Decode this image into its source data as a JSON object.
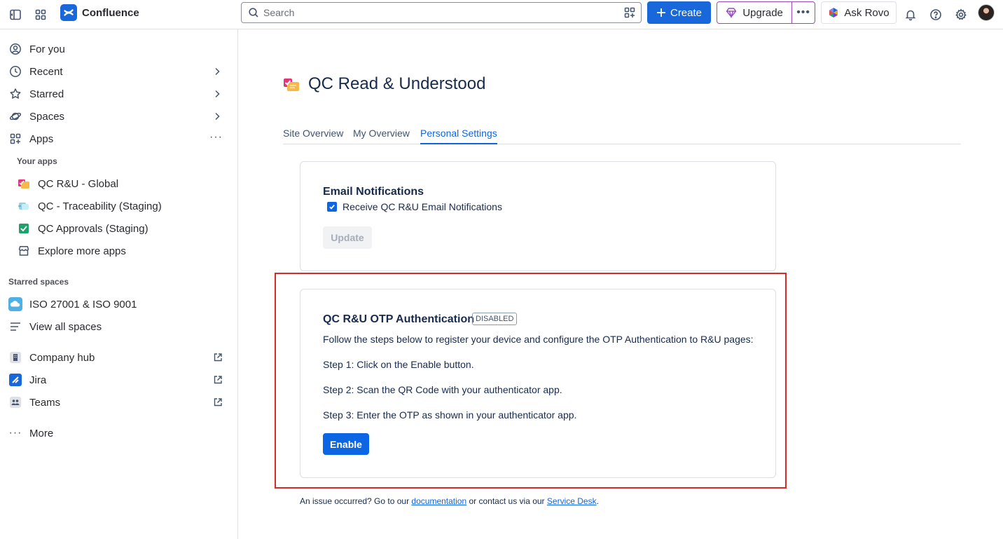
{
  "app": {
    "name": "Confluence"
  },
  "topbar": {
    "search_placeholder": "Search",
    "create_label": "Create",
    "upgrade_label": "Upgrade",
    "rovo_label": "Ask Rovo"
  },
  "sidebar": {
    "nav": [
      {
        "label": "For you"
      },
      {
        "label": "Recent"
      },
      {
        "label": "Starred"
      },
      {
        "label": "Spaces"
      },
      {
        "label": "Apps"
      }
    ],
    "your_apps_heading": "Your apps",
    "apps": [
      {
        "label": "QC R&U - Global"
      },
      {
        "label": "QC - Traceability (Staging)"
      },
      {
        "label": "QC Approvals (Staging)"
      },
      {
        "label": "Explore more apps"
      }
    ],
    "starred_spaces_heading": "Starred spaces",
    "spaces": [
      {
        "label": "ISO 27001 & ISO 9001"
      },
      {
        "label": "View all spaces"
      }
    ],
    "links": [
      {
        "label": "Company hub"
      },
      {
        "label": "Jira"
      },
      {
        "label": "Teams"
      }
    ],
    "more_label": "More"
  },
  "page": {
    "title": "QC Read & Understood",
    "tabs": [
      {
        "label": "Site Overview"
      },
      {
        "label": "My Overview"
      },
      {
        "label": "Personal Settings"
      }
    ],
    "email_card": {
      "title": "Email Notifications",
      "checkbox_label": "Receive QC R&U Email Notifications",
      "update_label": "Update"
    },
    "otp_card": {
      "title": "QC R&U OTP Authentication",
      "status": "DISABLED",
      "intro": "Follow the steps below to register your device and configure the OTP Authentication to R&U pages:",
      "step1": "Step 1: Click on the Enable button.",
      "step2": "Step 2: Scan the QR Code with your authenticator app.",
      "step3": "Step 3: Enter the OTP as shown in your authenticator app.",
      "enable_label": "Enable"
    },
    "footer": {
      "prefix": "An issue occurred? Go to our ",
      "doc_link": "documentation",
      "middle": " or contact us via our ",
      "desk_link": "Service Desk",
      "suffix": "."
    }
  },
  "colors": {
    "brand_blue": "#1868db",
    "highlight_red": "#d92a2a",
    "upgrade_purple": "#964ac0"
  }
}
